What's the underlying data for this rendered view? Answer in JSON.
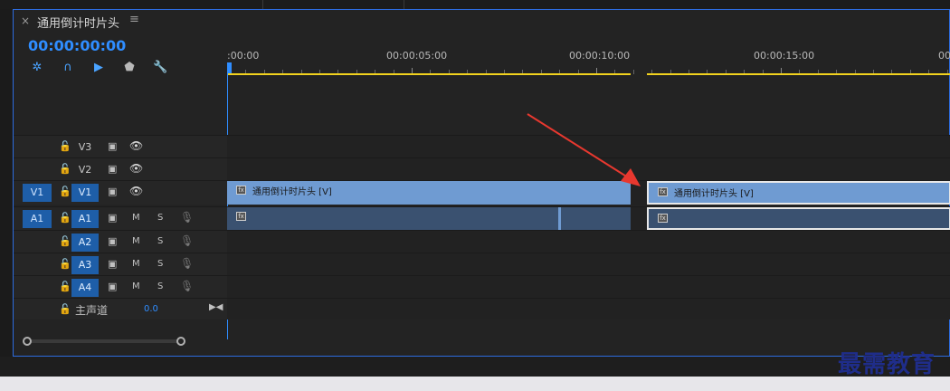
{
  "sequence": {
    "title": "通用倒计时片头",
    "timecode": "00:00:00:00"
  },
  "ruler": {
    "labels": [
      ":00:00",
      "00:00:05:00",
      "00:00:10:00",
      "00:00:15:00",
      "00:0"
    ]
  },
  "tracks": {
    "video": [
      {
        "name": "V3",
        "source": ""
      },
      {
        "name": "V2",
        "source": ""
      },
      {
        "name": "V1",
        "source": "V1"
      }
    ],
    "audio": [
      {
        "name": "A1",
        "source": "A1",
        "m": "M",
        "s": "S"
      },
      {
        "name": "A2",
        "source": "",
        "m": "M",
        "s": "S"
      },
      {
        "name": "A3",
        "source": "",
        "m": "M",
        "s": "S"
      },
      {
        "name": "A4",
        "source": "",
        "m": "M",
        "s": "S"
      }
    ],
    "master": {
      "label": "主声道",
      "value": "0.0"
    }
  },
  "clips": {
    "video1_label": "通用倒计时片头 [V]",
    "video2_label": "通用倒计时片头 [V]"
  },
  "icons": {
    "close": "close-icon",
    "menu": "hamburger-icon",
    "lock": "lock-icon",
    "film": "film-icon",
    "eye": "eye-icon",
    "mic": "mic-icon"
  },
  "colors": {
    "accent": "#2f8dff",
    "clip_video": "#6f9bd2",
    "clip_audio": "#3a5170",
    "work_area": "#f2d21e",
    "arrow": "#e8382f"
  },
  "watermark": "最需教育"
}
